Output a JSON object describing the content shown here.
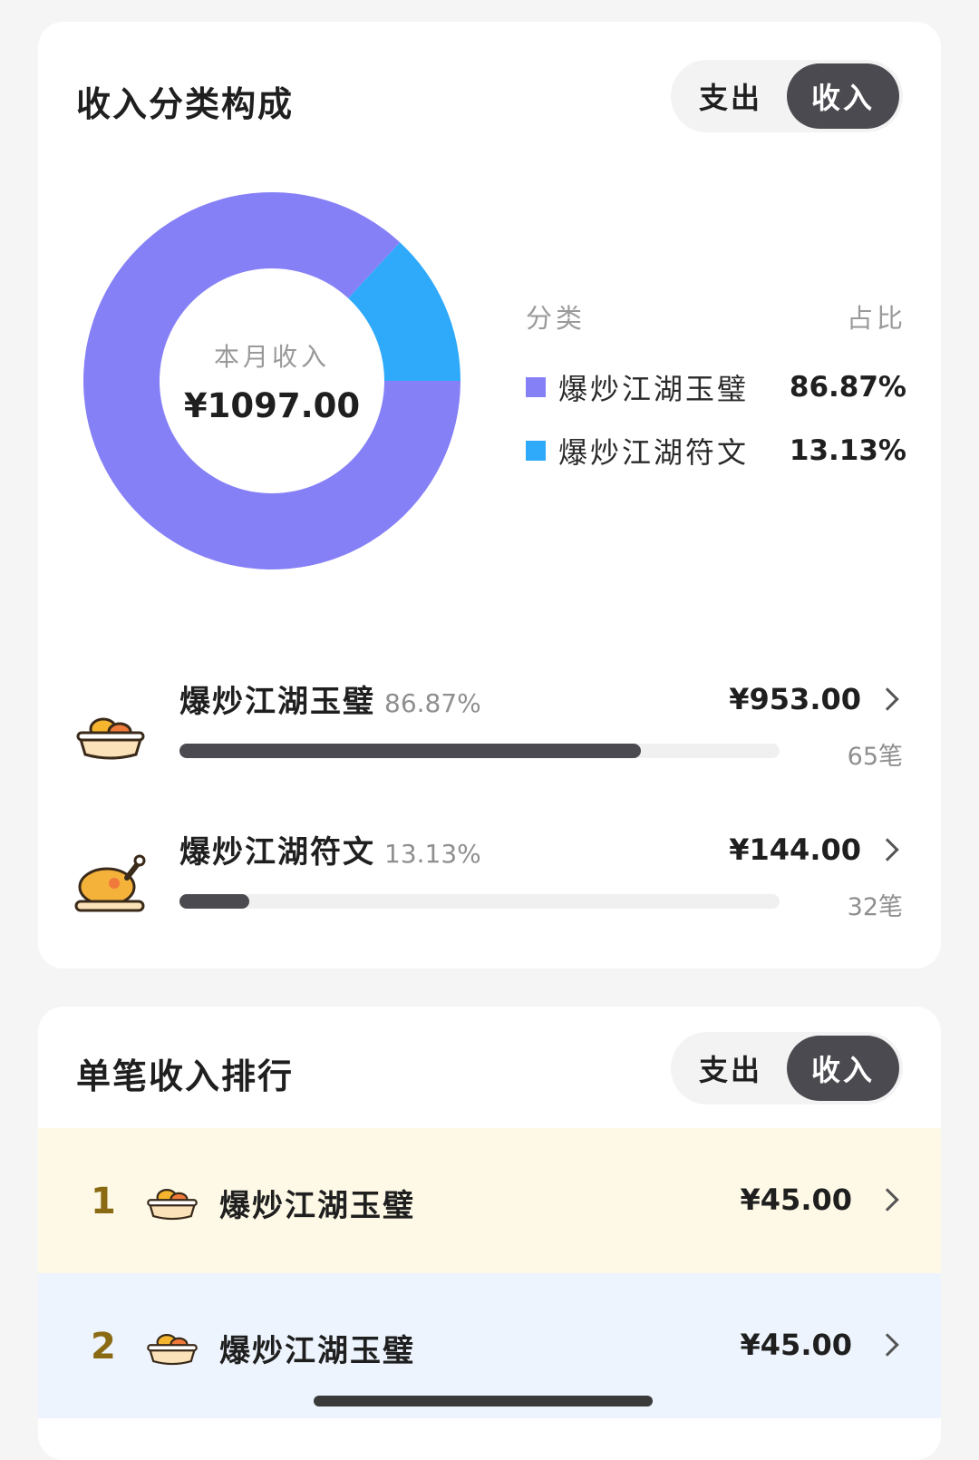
{
  "category_card": {
    "title": "收入分类构成",
    "toggle": {
      "expense_label": "支出",
      "income_label": "收入",
      "active": "income"
    },
    "donut": {
      "center_label": "本月收入",
      "center_value": "¥1097.00"
    },
    "legend": {
      "col_category": "分类",
      "col_share": "占比",
      "items": [
        {
          "name": "爆炒江湖玉璧",
          "pct": "86.87%",
          "color": "#8680f7"
        },
        {
          "name": "爆炒江湖符文",
          "pct": "13.13%",
          "color": "#2faafb"
        }
      ]
    },
    "rows": [
      {
        "name": "爆炒江湖玉璧",
        "pct": "86.87%",
        "amount": "¥953.00",
        "count": "65笔",
        "share": 0.8687,
        "icon": "bread-basket-icon"
      },
      {
        "name": "爆炒江湖符文",
        "pct": "13.13%",
        "amount": "¥144.00",
        "count": "32笔",
        "share": 0.1313,
        "icon": "roast-chicken-icon"
      }
    ]
  },
  "chart_data": {
    "type": "pie",
    "categories": [
      "爆炒江湖玉璧",
      "爆炒江湖符文"
    ],
    "values": [
      86.87,
      13.13
    ],
    "colors": [
      "#8680f7",
      "#2faafb"
    ],
    "title": "",
    "center_label": "本月收入",
    "center_value": "¥1097.00"
  },
  "ranking_card": {
    "title": "单笔收入排行",
    "toggle": {
      "expense_label": "支出",
      "income_label": "收入",
      "active": "income"
    },
    "rows": [
      {
        "rank": "1",
        "name": "爆炒江湖玉璧",
        "amount": "¥45.00",
        "bg": "#fdf9e6",
        "icon": "bread-basket-icon"
      },
      {
        "rank": "2",
        "name": "爆炒江湖玉璧",
        "amount": "¥45.00",
        "bg": "#edf4fd",
        "icon": "bread-basket-icon"
      }
    ]
  }
}
